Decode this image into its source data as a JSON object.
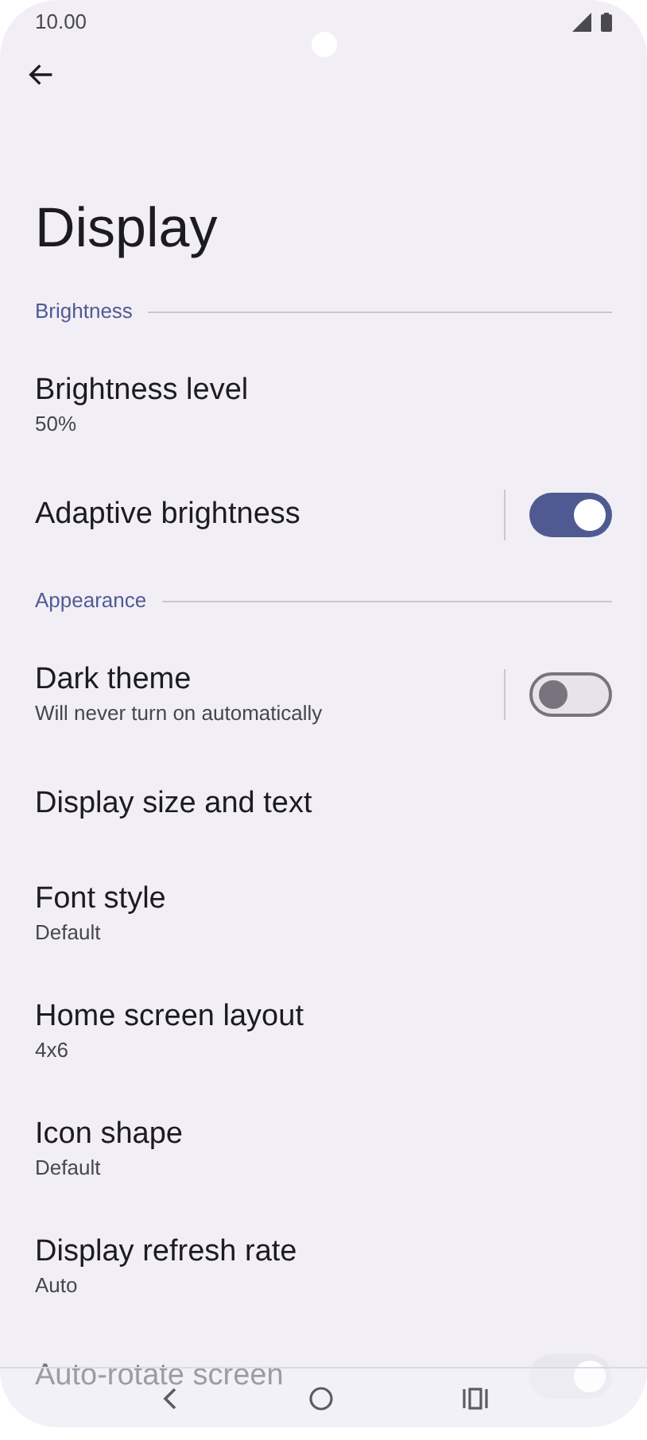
{
  "status_bar": {
    "time": "10.00"
  },
  "title": "Display",
  "items": [
    {
      "kind": "header",
      "label": "Brightness"
    },
    {
      "kind": "text",
      "label": "Brightness level",
      "summary": "50%"
    },
    {
      "kind": "switch",
      "label": "Adaptive brightness",
      "on": true
    },
    {
      "kind": "header",
      "label": "Appearance"
    },
    {
      "kind": "switch",
      "label": "Dark theme",
      "summary": "Will never turn on automatically",
      "on": false
    },
    {
      "kind": "text",
      "label": "Display size and text"
    },
    {
      "kind": "text",
      "label": "Font style",
      "summary": "Default"
    },
    {
      "kind": "text",
      "label": "Home screen layout",
      "summary": "4x6"
    },
    {
      "kind": "text",
      "label": "Icon shape",
      "summary": "Default"
    },
    {
      "kind": "text",
      "label": "Display refresh rate",
      "summary": "Auto"
    },
    {
      "kind": "switch",
      "label": "Auto-rotate screen",
      "on": true,
      "faded": true
    }
  ]
}
